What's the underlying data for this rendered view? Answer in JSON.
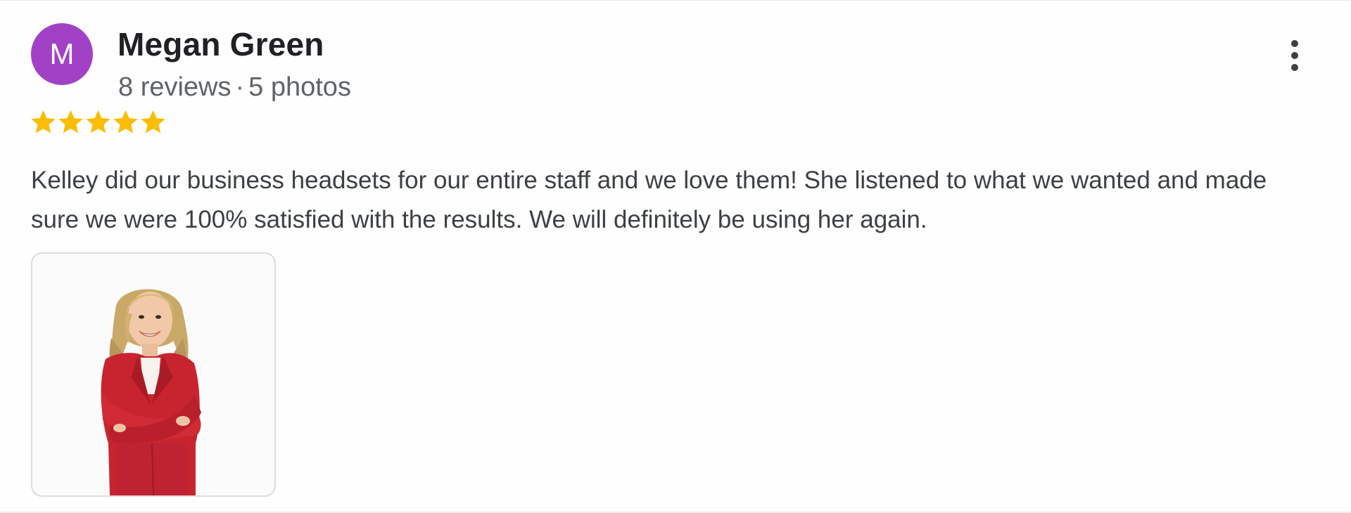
{
  "review": {
    "avatar": {
      "initial": "M",
      "color": "#a142c6"
    },
    "author_name": "Megan Green",
    "reviews_count": "8 reviews",
    "separator": "·",
    "photos_count": "5 photos",
    "rating": 5,
    "rating_max": 5,
    "star_color": "#fbbc04",
    "text": "Kelley did our business headsets for our entire staff and we love them! She listened to what we wanted and made sure we were 100% satisfied with the results. We will definitely be using her again.",
    "more_menu_icon": "more-vert-icon",
    "photo": {
      "subject": "review-photo-woman-in-red-blazer"
    }
  }
}
